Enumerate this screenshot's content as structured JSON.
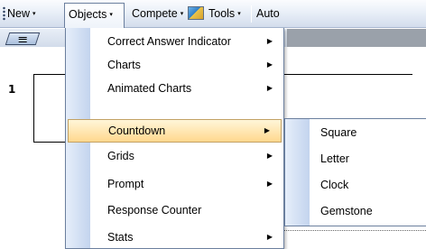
{
  "toolbar": {
    "new_label": "New",
    "objects_label": "Objects",
    "compete_label": "Compete",
    "tools_label": "Tools",
    "mode_text": "Auto",
    "caret": "▾"
  },
  "slide": {
    "row_number": "1"
  },
  "menu": {
    "items": [
      {
        "label": "Correct Answer Indicator",
        "arrow": "▶"
      },
      {
        "label": "Charts",
        "arrow": "▶"
      },
      {
        "label": "Animated Charts",
        "arrow": "▶"
      },
      {
        "label": "Countdown",
        "arrow": "▶"
      },
      {
        "label": "Grids",
        "arrow": "▶"
      },
      {
        "label": "Prompt",
        "arrow": "▶"
      },
      {
        "label": "Response Counter",
        "arrow": ""
      },
      {
        "label": "Stats",
        "arrow": "▶"
      }
    ],
    "active_item": "Countdown"
  },
  "submenu": {
    "items": [
      {
        "label": "Square"
      },
      {
        "label": "Letter"
      },
      {
        "label": "Clock"
      },
      {
        "label": "Gemstone"
      }
    ]
  },
  "colors": {
    "highlight": "#ffd88e",
    "menu_border": "#6b7f9e",
    "gutter": "#c3d4ee"
  }
}
